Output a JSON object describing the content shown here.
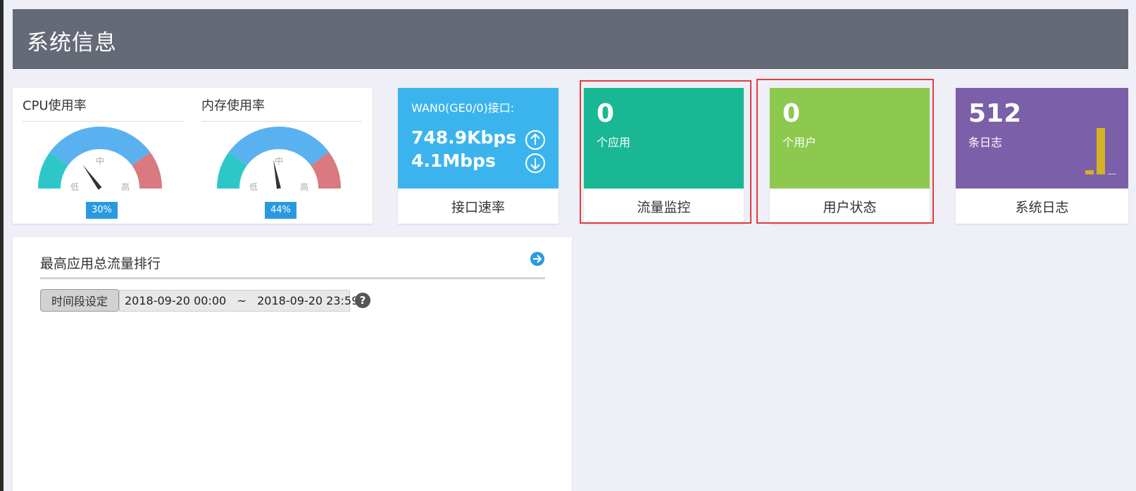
{
  "header": {
    "title": "系统信息"
  },
  "gauges": {
    "cpu": {
      "title": "CPU使用率",
      "value": 30,
      "label": "30%",
      "mid": "中",
      "low": "低",
      "high": "高"
    },
    "mem": {
      "title": "内存使用率",
      "value": 44,
      "label": "44%",
      "mid": "中",
      "low": "低",
      "high": "高"
    },
    "colors": {
      "low": "#2ec7c9",
      "mid": "#5ab1ef",
      "high": "#d87a80",
      "needle": "#333333"
    }
  },
  "interface_tile": {
    "name": "WAN0(GE0/0)接口:",
    "up_rate": "748.9Kbps",
    "down_rate": "4.1Mbps",
    "footer": "接口速率",
    "up_icon": "arrow-up-circle-icon",
    "down_icon": "arrow-down-circle-icon",
    "color": "#3bb4ee"
  },
  "flow_tile": {
    "count": "0",
    "unit": "个应用",
    "footer": "流量监控",
    "color": "#1ab795"
  },
  "user_tile": {
    "count": "0",
    "unit": "个用户",
    "footer": "用户状态",
    "color": "#8dc94f"
  },
  "log_tile": {
    "count": "512",
    "unit": "条日志",
    "footer": "系统日志",
    "color": "#7b5fa8",
    "bar_color": "#d4b226"
  },
  "traffic_panel": {
    "title": "最高应用总流量排行",
    "go_icon": "arrow-right-circle-icon",
    "time_button": "时间段设定",
    "time_range": "2018-09-20 00:00   ~   2018-09-20 23:59",
    "help_icon": "question-circle-icon",
    "help_glyph": "?"
  },
  "highlight_color": "#e03d3d"
}
